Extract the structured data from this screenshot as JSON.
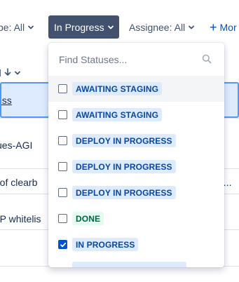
{
  "filters": {
    "type_label": "ype: All",
    "status_label": "In Progress",
    "assignee_label": "Assignee: All",
    "more_label": "Mor"
  },
  "background": {
    "header_label": "d",
    "rows": [
      {
        "text": "cess",
        "right": ""
      },
      {
        "text": "sues-AGI",
        "right": ""
      },
      {
        "text": "e of clearb",
        "right": "d..."
      },
      {
        "text": "f IP whitelis",
        "right": ""
      }
    ]
  },
  "dropdown": {
    "search_placeholder": "Find Statuses...",
    "options": [
      {
        "label": "AWAITING STAGING",
        "checked": false,
        "color": "blue"
      },
      {
        "label": "AWAITING STAGING",
        "checked": false,
        "color": "blue"
      },
      {
        "label": "DEPLOY IN PROGRESS",
        "checked": false,
        "color": "blue"
      },
      {
        "label": "DEPLOY IN PROGRESS",
        "checked": false,
        "color": "blue"
      },
      {
        "label": "DEPLOY IN PROGRESS",
        "checked": false,
        "color": "blue"
      },
      {
        "label": "DONE",
        "checked": false,
        "color": "green"
      },
      {
        "label": "IN PROGRESS",
        "checked": true,
        "color": "blue"
      }
    ]
  },
  "colors": {
    "accent": "#0052cc",
    "status_button_bg": "#42526e",
    "lozenge_blue_bg": "#deebff",
    "lozenge_blue_text": "#0747a6",
    "lozenge_green_bg": "#e3fcef",
    "lozenge_green_text": "#006644"
  }
}
